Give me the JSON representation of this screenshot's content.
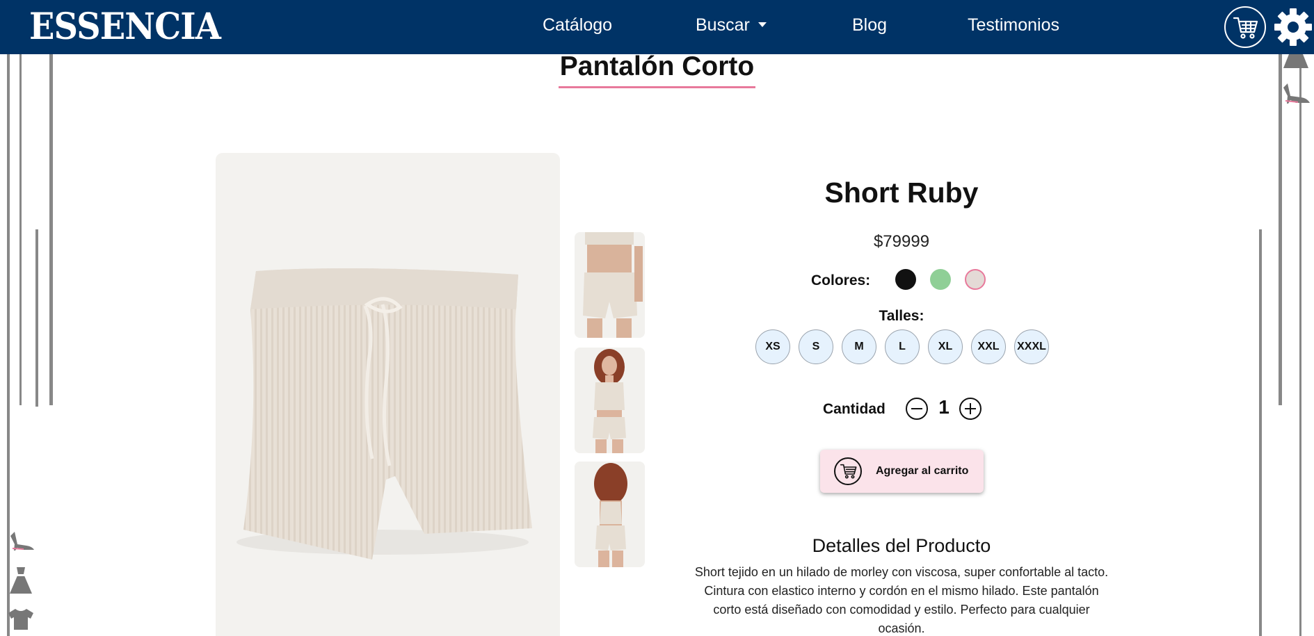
{
  "header": {
    "brand": "ESSENCIA",
    "nav": [
      {
        "label": "Catálogo"
      },
      {
        "label": "Buscar"
      },
      {
        "label": "Blog"
      },
      {
        "label": "Testimonios"
      }
    ],
    "background_color": "#003366",
    "icons": [
      "cart-icon",
      "gear-icon",
      "chevron-down-icon"
    ]
  },
  "page": {
    "title": "Pantalón Corto",
    "title_underline_color": "#e8799b"
  },
  "product": {
    "name": "Short Ruby",
    "price": "$79999",
    "colors_label": "Colores:",
    "colors": [
      "#111111",
      "#8fcf96",
      "#e4dad6"
    ],
    "sizes_label": "Talles:",
    "sizes": [
      "XS",
      "S",
      "M",
      "L",
      "XL",
      "XXL",
      "XXXL"
    ],
    "quantity_label": "Cantidad",
    "quantity": "1",
    "add_to_cart": "Agregar al carrito",
    "details_title": "Detalles del Producto",
    "details_text": "Short tejido en un hilado de morley con viscosa, super confortable al tacto. Cintura con elastico interno y cordón en el mismo hilado. Este pantalón corto está diseñado con comodidad y estilo. Perfecto para cualquier ocasión."
  },
  "decorations": [
    "dress-icon",
    "heels-icon",
    "tshirt-icon"
  ]
}
